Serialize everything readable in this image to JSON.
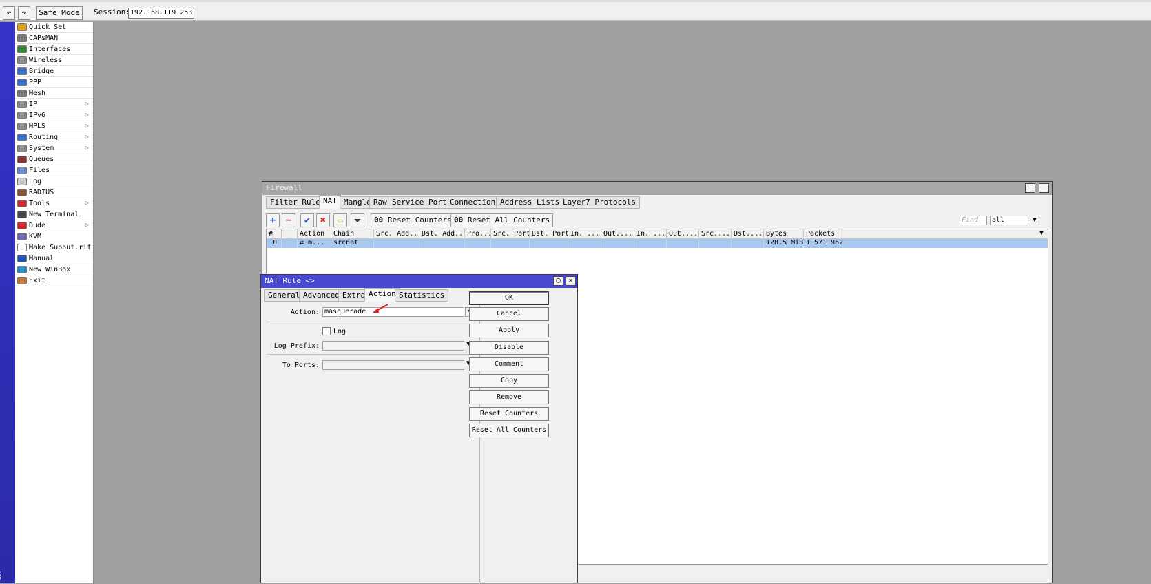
{
  "toolbar": {
    "undo_icon": "undo-icon",
    "redo_icon": "redo-icon",
    "safe_mode": "Safe Mode",
    "session_label": "Session:",
    "session_value": "192.168.119.253"
  },
  "side_strip_text": "OX",
  "menu": [
    {
      "label": "Quick Set",
      "icon": "quick-set-icon",
      "color": "#d9a320",
      "arrow": ""
    },
    {
      "label": "CAPsMAN",
      "icon": "capsman-icon",
      "color": "#7a7a7a",
      "arrow": ""
    },
    {
      "label": "Interfaces",
      "icon": "interfaces-icon",
      "color": "#3a8a3a",
      "arrow": ""
    },
    {
      "label": "Wireless",
      "icon": "wireless-icon",
      "color": "#8a8a8a",
      "arrow": ""
    },
    {
      "label": "Bridge",
      "icon": "bridge-icon",
      "color": "#3b73c8",
      "arrow": ""
    },
    {
      "label": "PPP",
      "icon": "ppp-icon",
      "color": "#3b73c8",
      "arrow": ""
    },
    {
      "label": "Mesh",
      "icon": "mesh-icon",
      "color": "#7a7a7a",
      "arrow": ""
    },
    {
      "label": "IP",
      "icon": "ip-icon",
      "color": "#8a8a8a",
      "arrow": "▷"
    },
    {
      "label": "IPv6",
      "icon": "ipv6-icon",
      "color": "#8a8a8a",
      "arrow": "▷"
    },
    {
      "label": "MPLS",
      "icon": "mpls-icon",
      "color": "#8a8a8a",
      "arrow": "▷"
    },
    {
      "label": "Routing",
      "icon": "routing-icon",
      "color": "#3b73c8",
      "arrow": "▷"
    },
    {
      "label": "System",
      "icon": "system-icon",
      "color": "#8a8a8a",
      "arrow": "▷"
    },
    {
      "label": "Queues",
      "icon": "queues-icon",
      "color": "#8a3a3a",
      "arrow": ""
    },
    {
      "label": "Files",
      "icon": "files-icon",
      "color": "#6a8ac8",
      "arrow": ""
    },
    {
      "label": "Log",
      "icon": "log-icon",
      "color": "#c8c8c8",
      "arrow": ""
    },
    {
      "label": "RADIUS",
      "icon": "radius-icon",
      "color": "#8a5a3a",
      "arrow": ""
    },
    {
      "label": "Tools",
      "icon": "tools-icon",
      "color": "#c83a3a",
      "arrow": "▷"
    },
    {
      "label": "New Terminal",
      "icon": "terminal-icon",
      "color": "#4a4a4a",
      "arrow": ""
    },
    {
      "label": "Dude",
      "icon": "dude-icon",
      "color": "#d82a2a",
      "arrow": "▷"
    },
    {
      "label": "KVM",
      "icon": "kvm-icon",
      "color": "#6a6aa8",
      "arrow": ""
    },
    {
      "label": "Make Supout.rif",
      "icon": "supout-icon",
      "color": "#ffffff",
      "arrow": ""
    },
    {
      "label": "Manual",
      "icon": "manual-icon",
      "color": "#2a5ab8",
      "arrow": ""
    },
    {
      "label": "New WinBox",
      "icon": "winbox-icon",
      "color": "#2a8ac8",
      "arrow": ""
    },
    {
      "label": "Exit",
      "icon": "exit-icon",
      "color": "#c87a3a",
      "arrow": ""
    }
  ],
  "firewall": {
    "title": "Firewall",
    "tabs": [
      "Filter Rules",
      "NAT",
      "Mangle",
      "Raw",
      "Service Ports",
      "Connections",
      "Address Lists",
      "Layer7 Protocols"
    ],
    "active_tab": "NAT",
    "reset_counters": "Reset Counters",
    "reset_all_counters": "Reset All Counters",
    "counter_glyph": "00",
    "find_placeholder": "Find",
    "filter_value": "all",
    "columns": [
      "#",
      "",
      "Action",
      "Chain",
      "Src. Add...",
      "Dst. Add...",
      "Pro...",
      "Src. Port",
      "Dst. Port",
      "In. ...",
      "Out....",
      "In. ...",
      "Out....",
      "Src....",
      "Dst....",
      "Bytes",
      "Packets"
    ],
    "rows": [
      [
        "0",
        "",
        "⇄ m...",
        "srcnat",
        "",
        "",
        "",
        "",
        "",
        "",
        "",
        "",
        "",
        "",
        "",
        "128.5 MiB",
        "1 571 962"
      ]
    ]
  },
  "nat_rule": {
    "title": "NAT Rule <>",
    "tabs": [
      "General",
      "Advanced",
      "Extra",
      "Action",
      "Statistics"
    ],
    "active_tab": "Action",
    "action_label": "Action:",
    "action_value": "masquerade",
    "log_label": "Log",
    "log_checked": false,
    "log_prefix_label": "Log Prefix:",
    "to_ports_label": "To Ports:",
    "buttons": [
      "OK",
      "Cancel",
      "Apply",
      "Disable",
      "Comment",
      "Copy",
      "Remove",
      "Reset Counters",
      "Reset All Counters"
    ]
  },
  "colors": {
    "title_active": "#4848d0",
    "title_inactive": "#a8a8a8",
    "selected_row": "#a9c8f0",
    "annotation_arrow": "#e02020"
  }
}
